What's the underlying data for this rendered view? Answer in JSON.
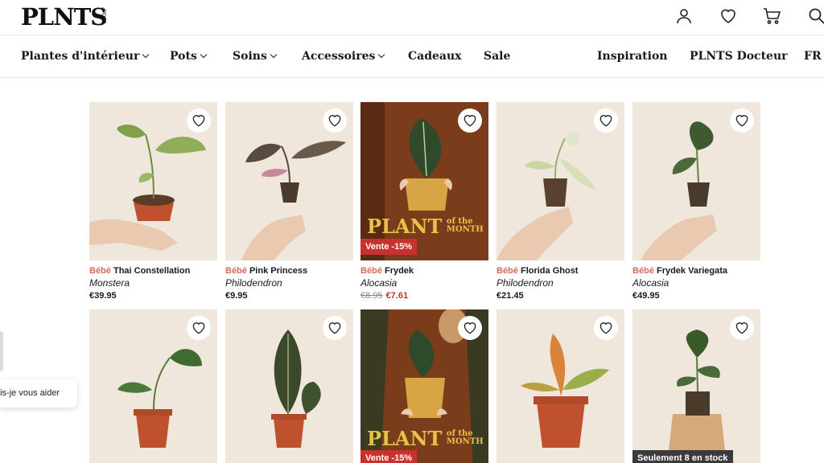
{
  "brand": {
    "logo": "PLNTS",
    "domain": ".com"
  },
  "header_icons": [
    "user-icon",
    "heart-icon",
    "cart-icon",
    "search-icon"
  ],
  "nav": {
    "plantes": "Plantes d'intérieur",
    "pots": "Pots",
    "soins": "Soins",
    "accessoires": "Accessoires",
    "cadeaux": "Cadeaux",
    "sale": "Sale",
    "inspiration": "Inspiration",
    "docteur": "PLNTS Docteur",
    "lang": "FR"
  },
  "products": [
    {
      "size": "Bébé",
      "name": "Thai Constellation",
      "genus": "Monstera",
      "price": "€39.95"
    },
    {
      "size": "Bébé",
      "name": "Pink Princess",
      "genus": "Philodendron",
      "price": "€9.95"
    },
    {
      "size": "Bébé",
      "name": "Frydek",
      "genus": "Alocasia",
      "old_price": "€8.95",
      "price": "€7.61",
      "promo_big": "PLANT",
      "promo_small1": "of the",
      "promo_small2": "MONTH",
      "badge": "Vente -15%"
    },
    {
      "size": "Bébé",
      "name": "Florida Ghost",
      "genus": "Philodendron",
      "price": "€21.45"
    },
    {
      "size": "Bébé",
      "name": "Frydek Variegata",
      "genus": "Alocasia",
      "price": "€49.95"
    }
  ],
  "row2": [
    {
      "badge": ""
    },
    {
      "badge": ""
    },
    {
      "promo_big": "PLANT",
      "promo_small1": "of the",
      "promo_small2": "MONTH",
      "badge": "Vente -15%"
    },
    {
      "badge": ""
    },
    {
      "badge": "Seulement 8 en stock"
    }
  ],
  "chat": {
    "label": "uis-je vous aider"
  },
  "colors": {
    "size_tag": "#d56a5a",
    "sale": "#c8312e",
    "promo_gold": "#e7c24a",
    "background": "#ffffff"
  }
}
